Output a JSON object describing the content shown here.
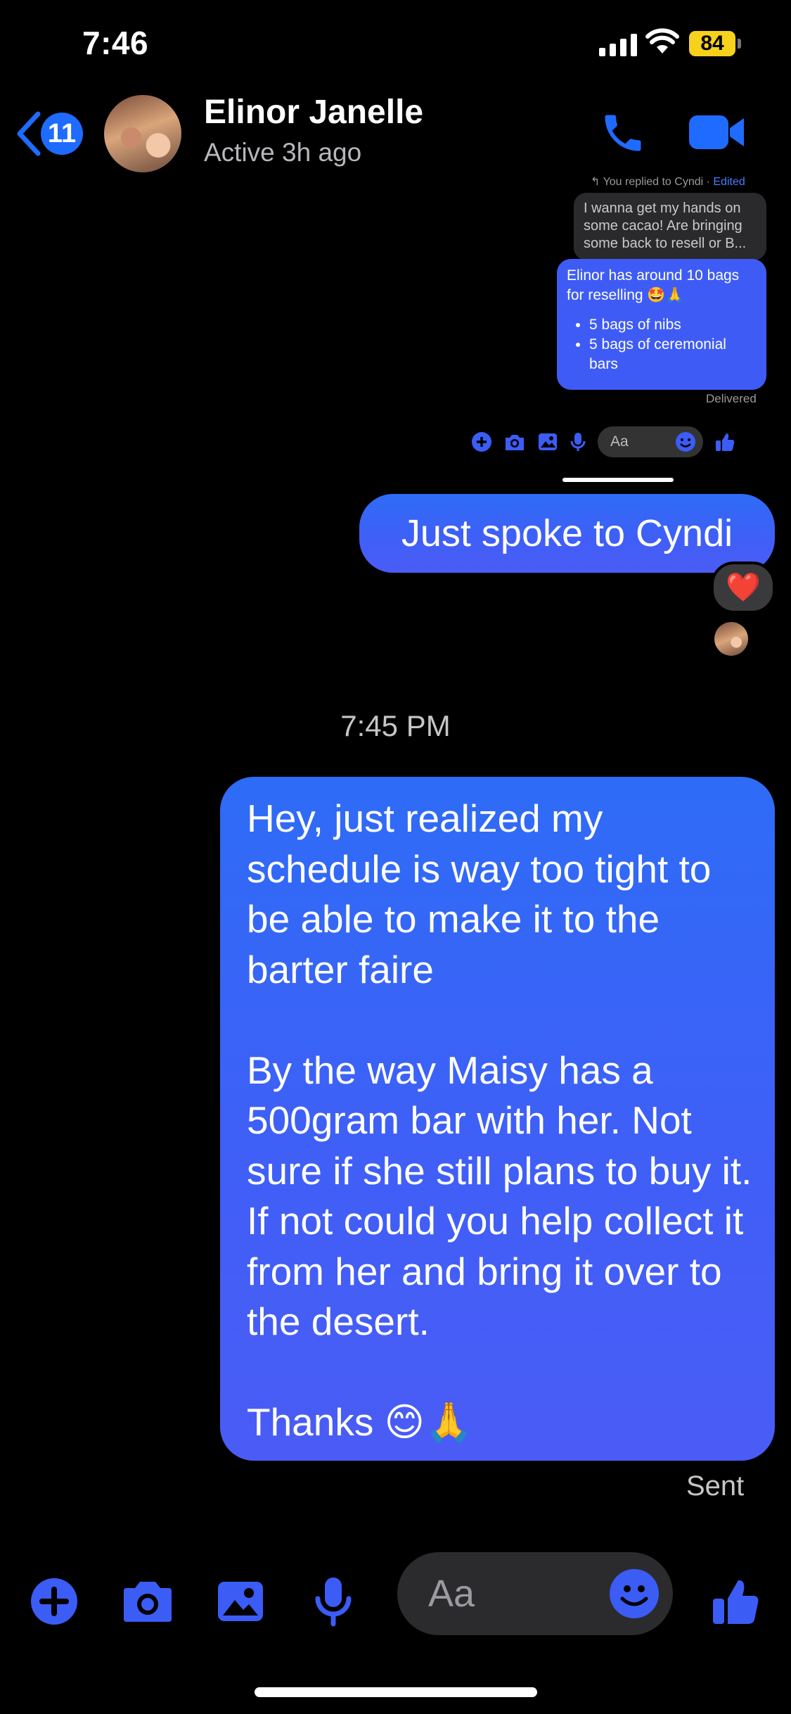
{
  "status_bar": {
    "time": "7:46",
    "battery": "84"
  },
  "header": {
    "back_count": "11",
    "contact_name": "Elinor Janelle",
    "contact_status": "Active 3h ago"
  },
  "embedded_screenshot": {
    "reply_note": "You replied to Cyndi",
    "reply_edited": "Edited",
    "quoted_text": "I wanna get my hands on some cacao! Are bringing some back to resell or B...",
    "message_intro": "Elinor has around 10 bags for reselling 🤩🙏",
    "message_items": [
      "5 bags of nibs",
      "5 bags of ceremonial bars"
    ],
    "delivered": "Delivered",
    "input_placeholder": "Aa"
  },
  "messages": [
    {
      "text": "Just spoke to Cyndi",
      "reaction": "❤️"
    }
  ],
  "time_separator": "7:45 PM",
  "long_message": {
    "paragraphs": [
      "Hey, just realized my schedule is way too tight to be able to make it to the barter faire",
      "By the way Maisy has a 500gram bar with her. Not sure if she still plans to buy it. If not could you help collect it from her and bring it over to the desert.",
      "Thanks 😊🙏"
    ]
  },
  "sent_status": "Sent",
  "composer": {
    "placeholder": "Aa"
  },
  "colors": {
    "accent": "#1f6bff",
    "bubble": "#3e5cf5",
    "background": "#000000"
  },
  "icons": [
    "chevron-left-icon",
    "phone-icon",
    "video-icon",
    "plus-icon",
    "camera-icon",
    "image-icon",
    "microphone-icon",
    "emoji-icon",
    "thumbs-up-icon"
  ]
}
